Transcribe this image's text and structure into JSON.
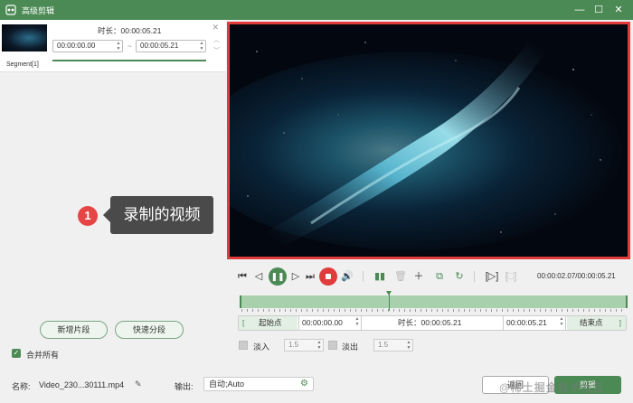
{
  "window": {
    "title": "高级剪辑"
  },
  "segment": {
    "label": "Segment[1]",
    "duration_label": "时长：",
    "duration_value": "00:00:05.21",
    "start_time": "00:00:00.00",
    "end_time": "00:00:05.21",
    "separator": "~"
  },
  "callout": {
    "number": "1",
    "text": "录制的视频"
  },
  "left_actions": {
    "new_segment": "新增片段",
    "quick_split": "快速分段"
  },
  "merge": {
    "checked": true,
    "label": "合并所有"
  },
  "player": {
    "time_display": "00:00:02.07/00:00:05.21"
  },
  "range": {
    "start_label": "起始点",
    "start_value": "00:00:00.00",
    "duration_label": "时长：",
    "duration_value": "00:00:05.21",
    "end_value": "00:00:05.21",
    "end_label": "结束点"
  },
  "fade": {
    "fade_in_label": "淡入",
    "fade_in_value": "1.5",
    "fade_out_label": "淡出",
    "fade_out_value": "1.5"
  },
  "bottom": {
    "name_label": "名称:",
    "name_value": "Video_230...30111.mp4",
    "output_label": "输出:",
    "output_value": "自动;Auto",
    "back_button": "返回",
    "ok_button": "剪辑"
  },
  "watermark": "@稀土掘金技术社区",
  "colors": {
    "accent": "#4c8a55",
    "highlight": "#e03c3c"
  }
}
